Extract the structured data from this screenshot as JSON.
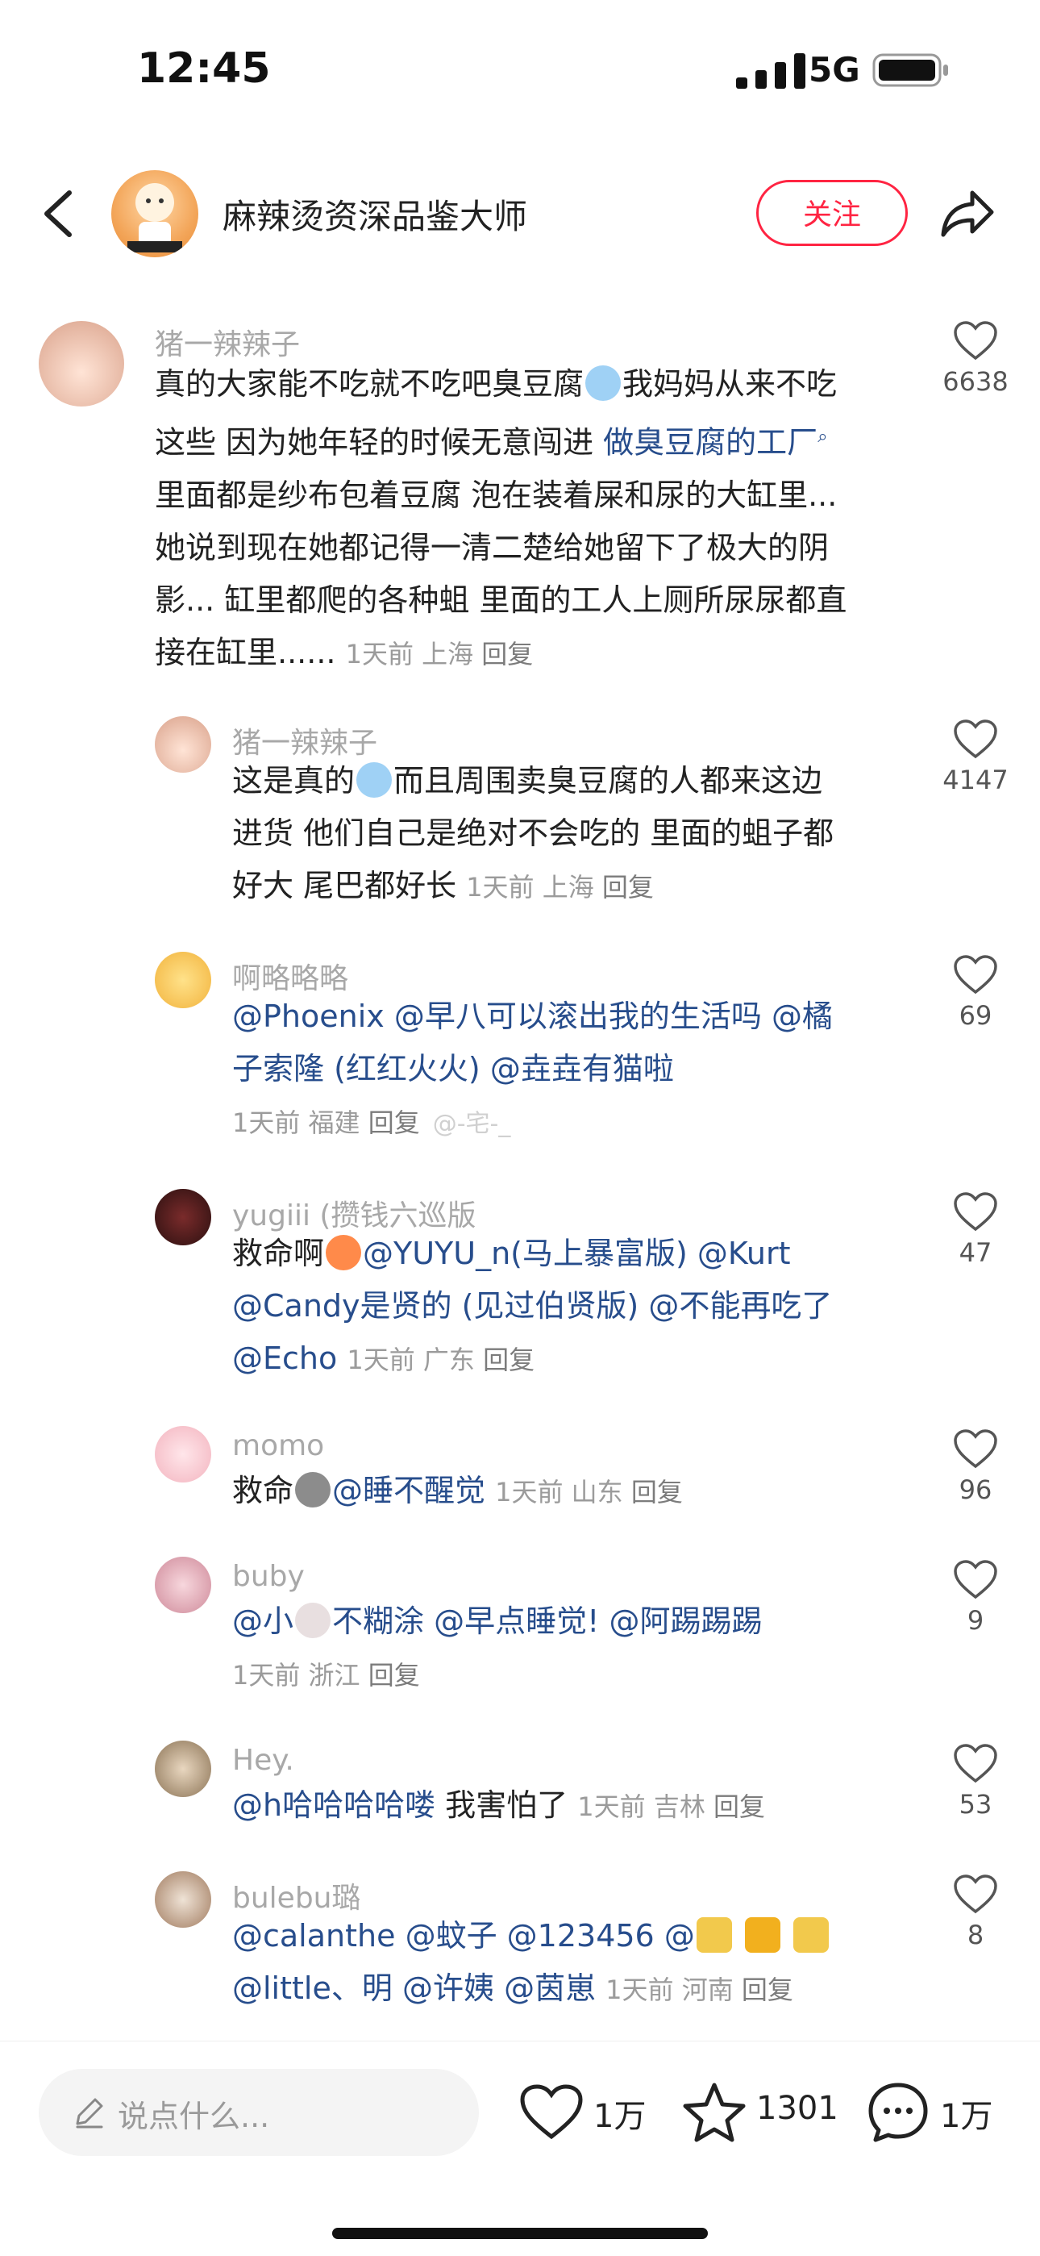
{
  "status": {
    "time": "12:45",
    "network": "5G"
  },
  "header": {
    "author": "麻辣烫资深品鉴大师",
    "follow_label": "关注"
  },
  "comments": [
    {
      "user": "猪一辣辣子",
      "lines": [
        "真的大家能不吃就不吃吧臭豆腐",
        "我妈妈从来不吃",
        "这些 因为她年轻的时候无意闯进 ",
        "做臭豆腐的工厂",
        "里面都是纱布包着豆腐 泡在装着屎和尿的大缸里...",
        "她说到现在她都记得一清二楚给她留下了极大的阴",
        "影... 缸里都爬的各种蛆 里面的工人上厕所尿尿都直",
        "接在缸里......"
      ],
      "meta": "1天前 上海",
      "reply": "回复",
      "likes": "6638"
    },
    {
      "user": "猪一辣辣子",
      "lines": [
        "这是真的",
        "而且周围卖臭豆腐的人都来这边",
        "进货 他们自己是绝对不会吃的 里面的蛆子都",
        "好大 尾巴都好长"
      ],
      "meta": "1天前 上海",
      "reply": "回复",
      "likes": "4147"
    },
    {
      "user": "啊略略略",
      "m1": "@Phoenix",
      "m2": "@早八可以滚出我的生活吗",
      "m3": "@橘",
      "m4": "子索隆 (红红火火)",
      "m5": "@垚垚有猫啦",
      "meta": "1天前 福建",
      "reply": "回复",
      "watermark": "@-宅-_",
      "likes": "69"
    },
    {
      "user": "yugiii (攒钱六巡版",
      "t1": "救命啊",
      "m1": "@YUYU_n(马上暴富版)",
      "m2": "@Kurt",
      "m3": "@Candy是贤的 (见过伯贤版)",
      "m4": "@不能再吃了",
      "m5": "@Echo",
      "meta": "1天前 广东",
      "reply": "回复",
      "likes": "47"
    },
    {
      "user": "momo",
      "t1": "救命",
      "m1": "@睡不醒觉",
      "meta": "1天前 山东",
      "reply": "回复",
      "likes": "96"
    },
    {
      "user": "buby",
      "m1": "@小",
      "m1b": "不糊涂",
      "m2": "@早点睡觉!",
      "m3": "@阿踢踢踢",
      "meta": "1天前 浙江",
      "reply": "回复",
      "likes": "9"
    },
    {
      "user": "Hey.",
      "m1": "@h哈哈哈哈喽",
      "t1": " 我害怕了",
      "meta": "1天前 吉林",
      "reply": "回复",
      "likes": "53"
    },
    {
      "user": "bulebu璐",
      "m1": "@calanthe",
      "m2": "@蚊子",
      "m3": "@123456",
      "m4": "@",
      "m5": "@little、明",
      "m6": "@许姨",
      "m7": "@茵崽",
      "meta": "1天前 河南",
      "reply": "回复",
      "likes": "8"
    }
  ],
  "bottom": {
    "placeholder": "说点什么...",
    "likes": "1万",
    "favorites": "1301",
    "comments": "1万"
  }
}
